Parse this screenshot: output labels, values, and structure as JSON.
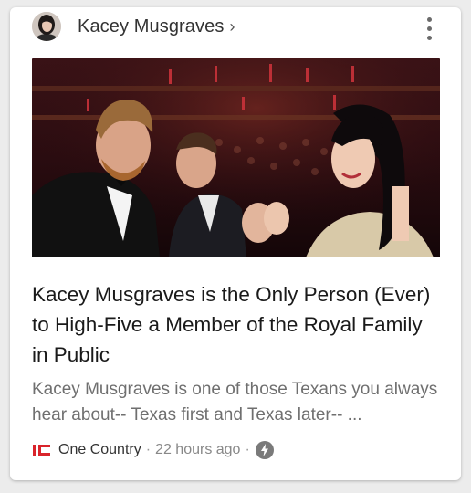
{
  "card": {
    "source_name": "Kacey Musgraves",
    "source_chevron": "›",
    "avatar_icon": "kacey-musgraves-avatar",
    "menu_icon": "more-vert-icon",
    "hero_image": "prince-harry-high-five-kacey-musgraves-photo",
    "headline": "Kacey Musgraves is the Only Person (Ever) to High-Five a Member of the Royal Family in Public",
    "snippet": "Kacey Musgraves is one of those Texans you always hear about-- Texas first and Texas later-- ...",
    "publisher": "One Country",
    "separator": "·",
    "time_ago": "22 hours ago",
    "publisher_logo": "one-country-logo",
    "amp_icon": "amp-bolt-icon",
    "accent_color": "#d9242b"
  }
}
